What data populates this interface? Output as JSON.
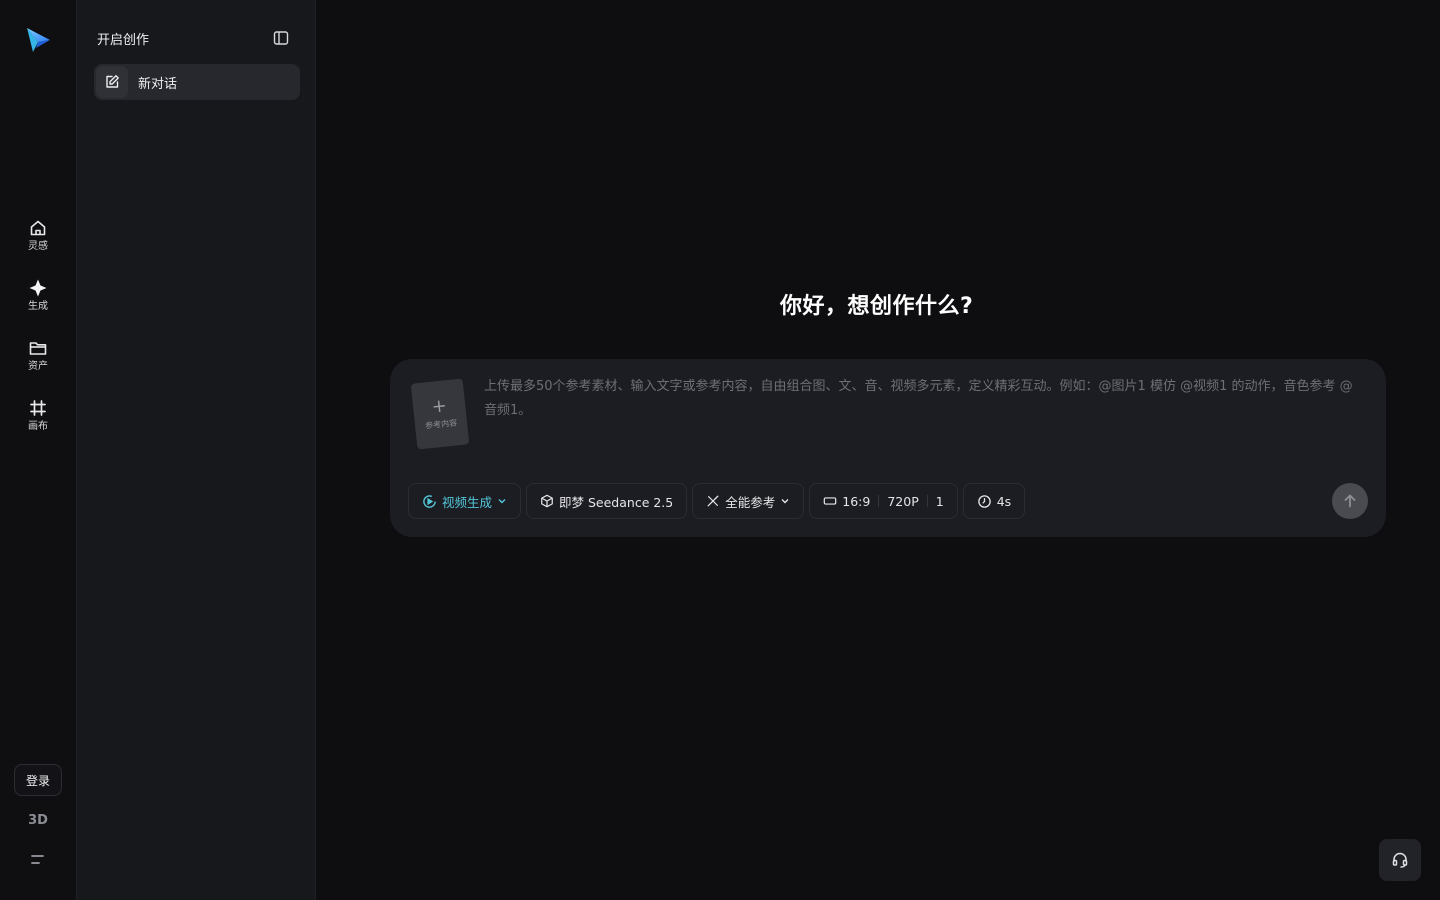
{
  "rail": {
    "items": [
      {
        "label": "灵感",
        "icon": "home-icon"
      },
      {
        "label": "生成",
        "icon": "sparkle-icon"
      },
      {
        "label": "资产",
        "icon": "folder-icon"
      },
      {
        "label": "画布",
        "icon": "canvas-icon"
      }
    ],
    "login_label": "登录",
    "three_d_label": "3D"
  },
  "panel": {
    "title": "开启创作",
    "new_chat_label": "新对话"
  },
  "main": {
    "heading": "你好，想创作什么?",
    "reference_card_label": "参考内容",
    "prompt_placeholder": "上传最多50个参考素材、输入文字或参考内容，自由组合图、文、音、视频多元素，定义精彩互动。例如：@图片1 模仿 @视频1 的动作，音色参考 @音频1。",
    "toolbar": {
      "mode_label": "视频生成",
      "model_label": "即梦 Seedance 2.5",
      "reference_label": "全能参考",
      "aspect_ratio": "16:9",
      "resolution": "720P",
      "count": "1",
      "duration": "4s"
    }
  },
  "colors": {
    "accent": "#53c7d9",
    "background": "#0e0e11",
    "panel": "#17181c",
    "composer": "#1c1d22"
  }
}
